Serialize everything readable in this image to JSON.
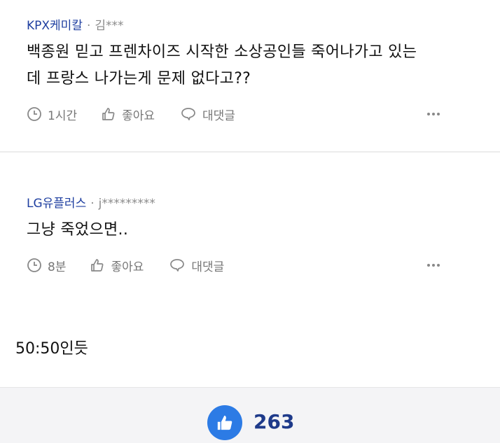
{
  "comments": [
    {
      "source": "KPX케미칼",
      "separator": "·",
      "user": "김***",
      "text_lines": [
        "백종원 믿고 프렌차이즈 시작한 소상공인들 죽어나가고 있는",
        "데 프랑스 나가는게 문제 없다고??"
      ],
      "time": "1시간",
      "like_label": "좋아요",
      "reply_label": "대댓글"
    },
    {
      "source": "LG유플러스",
      "separator": "·",
      "user": "j*********",
      "text_lines": [
        "그냥 죽었으면.."
      ],
      "time": "8분",
      "like_label": "좋아요",
      "reply_label": "대댓글"
    }
  ],
  "note": "50:50인듯",
  "footer": {
    "like_count": "263"
  },
  "colors": {
    "source": "#1f3fa0",
    "like_button": "#2c7be5",
    "like_count": "#1e3a8a"
  }
}
